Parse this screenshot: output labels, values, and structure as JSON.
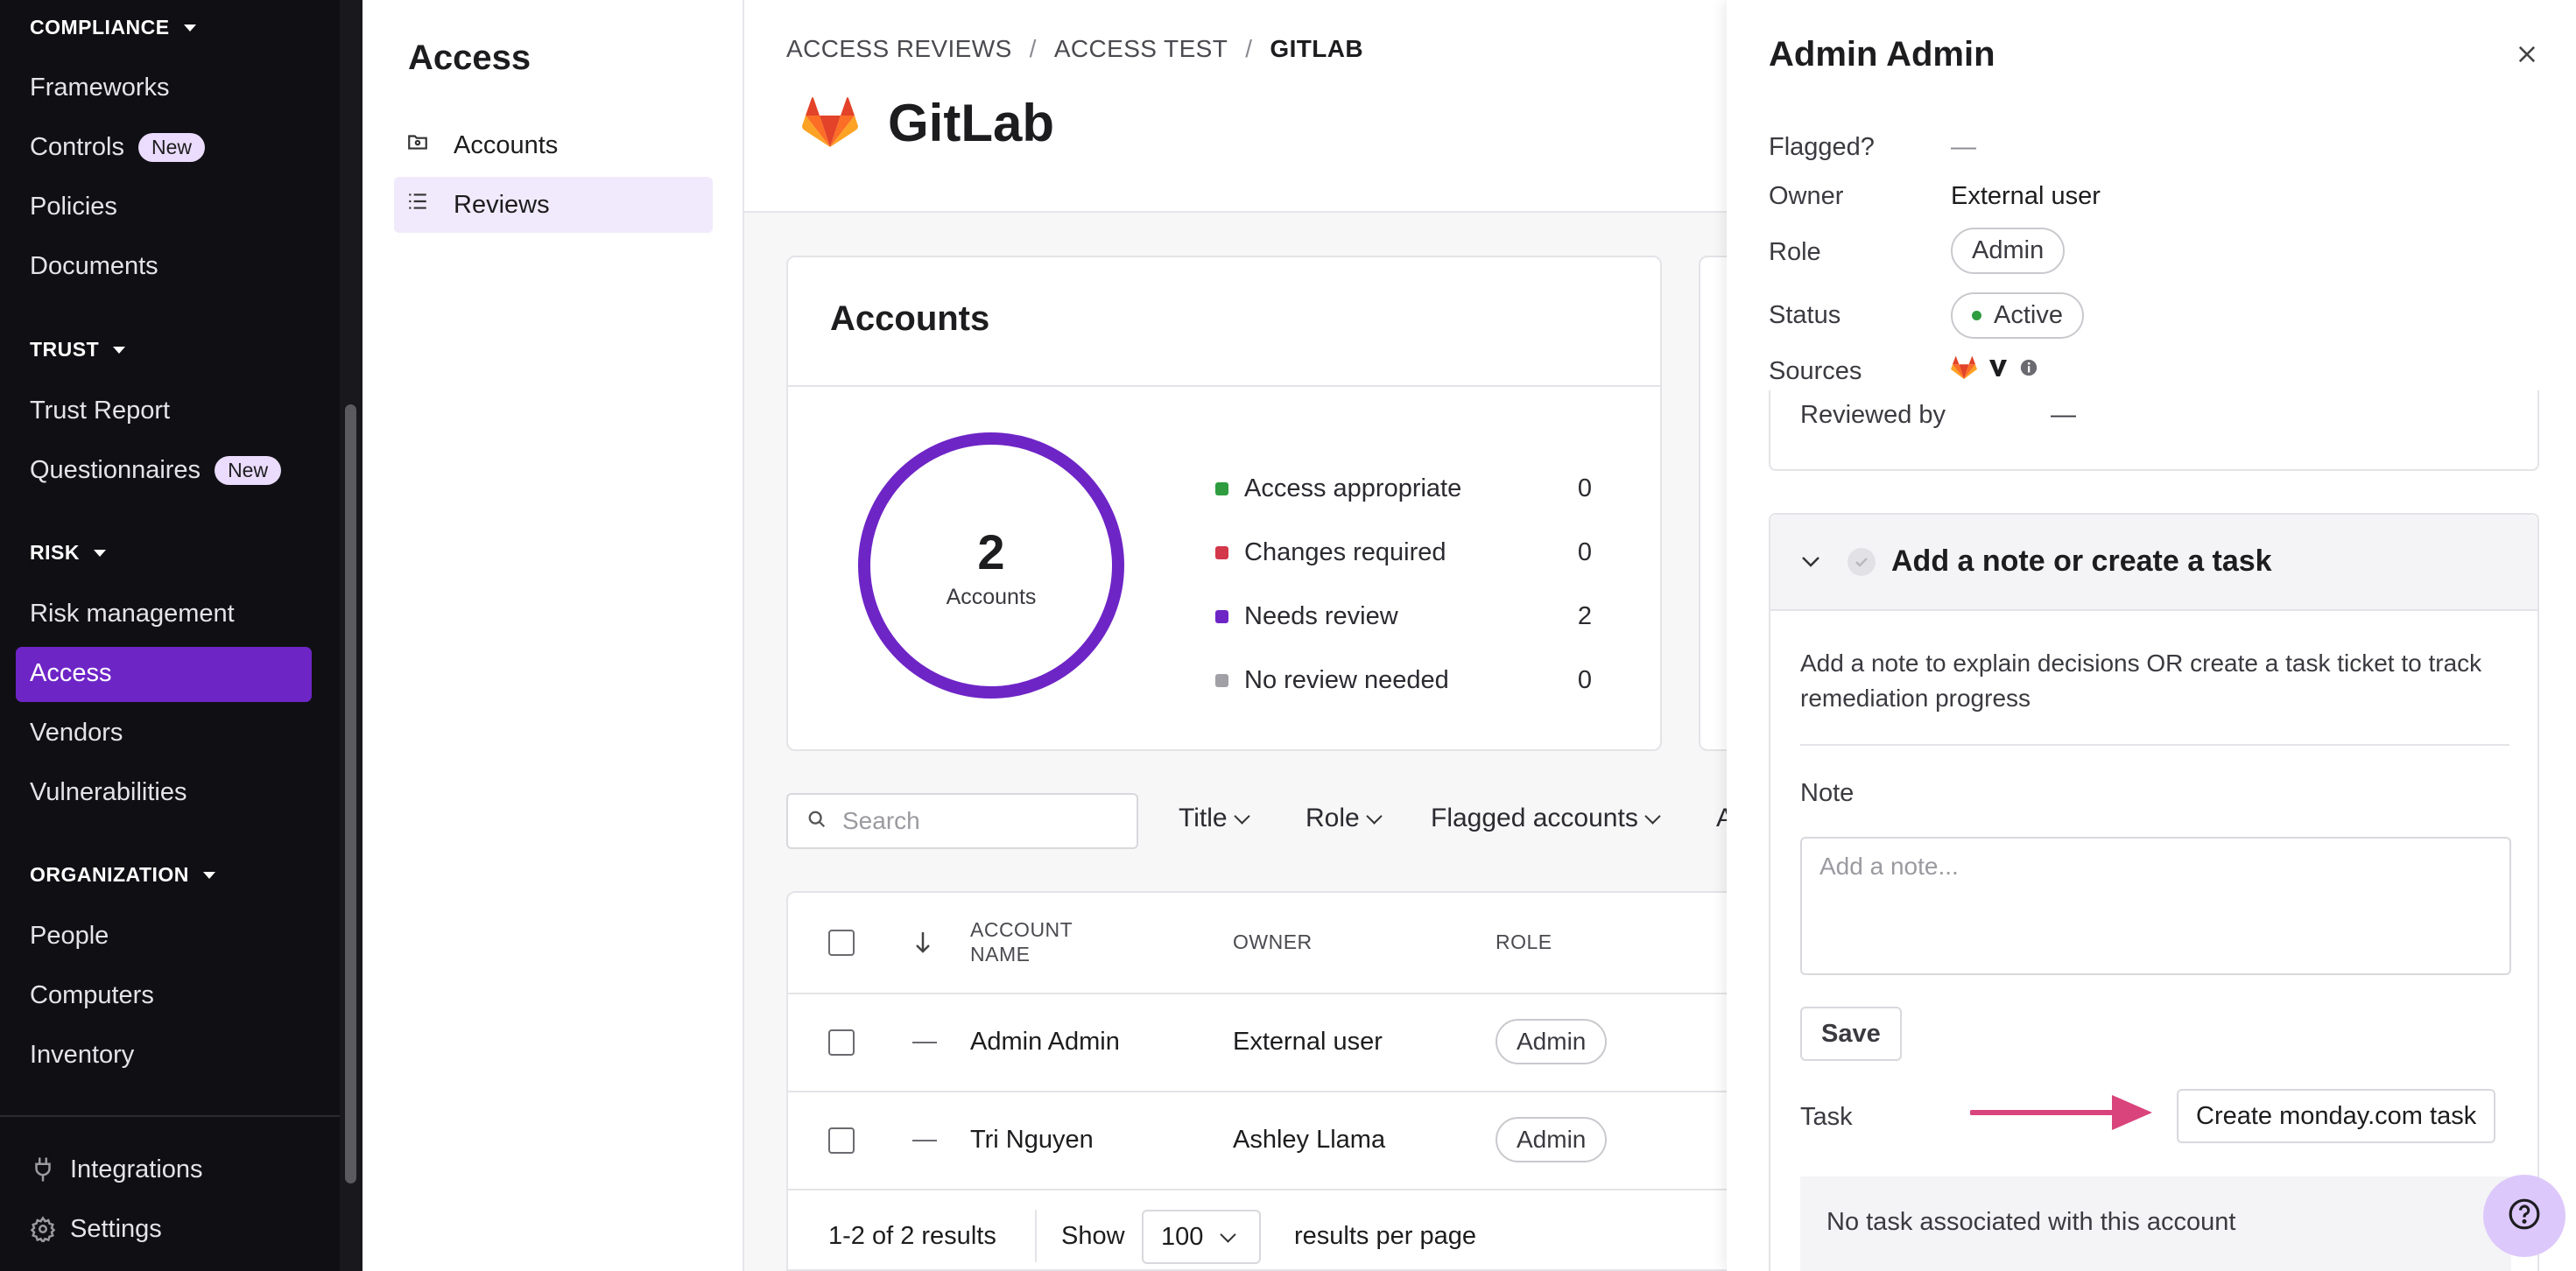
{
  "nav": {
    "sections": [
      {
        "label": "COMPLIANCE"
      },
      {
        "label": "TRUST"
      },
      {
        "label": "RISK"
      },
      {
        "label": "ORGANIZATION"
      }
    ],
    "items": {
      "frameworks": "Frameworks",
      "controls": "Controls",
      "controls_badge": "New",
      "policies": "Policies",
      "documents": "Documents",
      "trust_report": "Trust Report",
      "questionnaires": "Questionnaires",
      "questionnaires_badge": "New",
      "risk_management": "Risk management",
      "access": "Access",
      "vendors": "Vendors",
      "vulnerabilities": "Vulnerabilities",
      "people": "People",
      "computers": "Computers",
      "inventory": "Inventory",
      "integrations": "Integrations",
      "settings": "Settings"
    },
    "active": "Access"
  },
  "subnav": {
    "title": "Access",
    "items": [
      {
        "label": "Accounts",
        "icon": "folder-user-icon"
      },
      {
        "label": "Reviews",
        "icon": "list-icon",
        "active": true
      }
    ]
  },
  "main": {
    "breadcrumb": [
      "ACCESS REVIEWS",
      "ACCESS TEST",
      "GITLAB"
    ],
    "breadcrumb_sep": "/",
    "title": "GitLab",
    "accounts_card": {
      "title": "Accounts",
      "total": "2",
      "total_label": "Accounts",
      "legend": [
        {
          "label": "Access appropriate",
          "value": "0",
          "color": "#2e9c3f"
        },
        {
          "label": "Changes required",
          "value": "0",
          "color": "#d2374a"
        },
        {
          "label": "Needs review",
          "value": "2",
          "color": "#6e25c6"
        },
        {
          "label": "No review needed",
          "value": "0",
          "color": "#a0a0a6"
        }
      ]
    },
    "search": {
      "placeholder": "Search"
    },
    "filters": [
      "Title",
      "Role",
      "Flagged accounts",
      "A"
    ],
    "table": {
      "headers": {
        "account_name": "ACCOUNT NAME",
        "owner": "OWNER",
        "role": "ROLE"
      },
      "rows": [
        {
          "name": "Admin Admin",
          "owner": "External user",
          "role": "Admin"
        },
        {
          "name": "Tri Nguyen",
          "owner": "Ashley Llama",
          "role": "Admin"
        }
      ]
    },
    "pager": {
      "results": "1-2 of 2 results",
      "show": "Show",
      "per_page": "100",
      "per_page_suffix": "results per page"
    }
  },
  "drawer": {
    "title": "Admin Admin",
    "fields": {
      "flagged_label": "Flagged?",
      "flagged_value": "—",
      "owner_label": "Owner",
      "owner_value": "External user",
      "role_label": "Role",
      "role_value": "Admin",
      "status_label": "Status",
      "status_value": "Active",
      "sources_label": "Sources"
    },
    "reviewed_by_label": "Reviewed by",
    "reviewed_by_value": "—",
    "note_section": {
      "title": "Add a note or create a task",
      "description": "Add a note to explain decisions OR create a task ticket to track remediation progress",
      "note_label": "Note",
      "note_placeholder": "Add a note...",
      "save_label": "Save",
      "task_label": "Task",
      "task_button": "Create monday.com task",
      "no_task": "No task associated with this account"
    }
  },
  "colors": {
    "accent": "#6e25c6",
    "active_status": "#2e9c3f",
    "arrow": "#d9447c"
  }
}
